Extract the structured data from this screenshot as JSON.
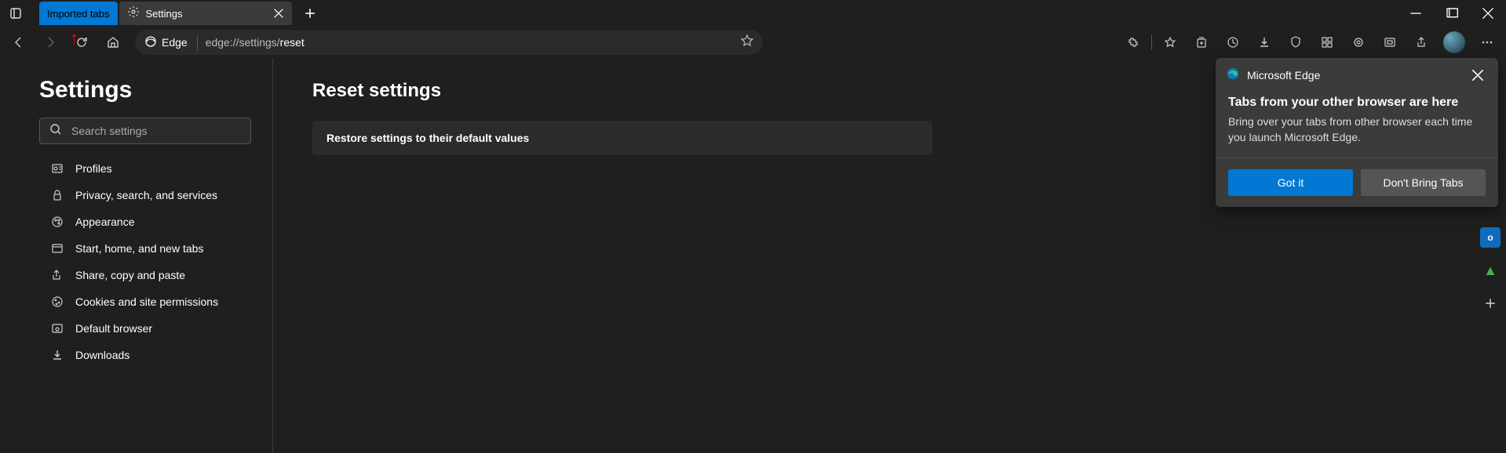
{
  "titlebar": {
    "imported_label": "Imported tabs",
    "active_tab": "Settings"
  },
  "toolbar": {
    "edge_label": "Edge",
    "url_prefix": "edge://settings/",
    "url_page": "reset"
  },
  "sidebar": {
    "title": "Settings",
    "search_placeholder": "Search settings",
    "items": [
      {
        "label": "Profiles"
      },
      {
        "label": "Privacy, search, and services"
      },
      {
        "label": "Appearance"
      },
      {
        "label": "Start, home, and new tabs"
      },
      {
        "label": "Share, copy and paste"
      },
      {
        "label": "Cookies and site permissions"
      },
      {
        "label": "Default browser"
      },
      {
        "label": "Downloads"
      }
    ]
  },
  "main": {
    "heading": "Reset settings",
    "card_label": "Restore settings to their default values"
  },
  "popup": {
    "app": "Microsoft Edge",
    "title": "Tabs from your other browser are here",
    "body": "Bring over your tabs from other browser each time you launch Microsoft Edge.",
    "primary": "Got it",
    "secondary": "Don't Bring Tabs"
  }
}
